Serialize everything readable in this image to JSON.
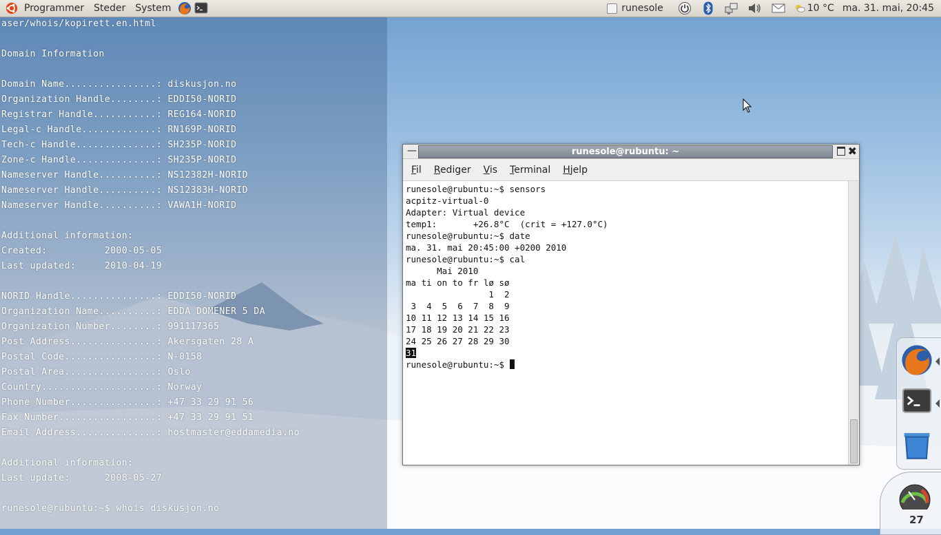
{
  "panel": {
    "menus": [
      "Programmer",
      "Steder",
      "System"
    ],
    "user": "runesole",
    "weather": "10 °C",
    "datetime": "ma. 31. mai, 20:45"
  },
  "left_terminal": {
    "lines": [
      "aser/whois/kopirett.en.html",
      "",
      "Domain Information",
      "",
      "Domain Name................: diskusjon.no",
      "Organization Handle........: EDDI50-NORID",
      "Registrar Handle...........: REG164-NORID",
      "Legal-c Handle.............: RN169P-NORID",
      "Tech-c Handle..............: SH235P-NORID",
      "Zone-c Handle..............: SH235P-NORID",
      "Nameserver Handle..........: NS12382H-NORID",
      "Nameserver Handle..........: NS12383H-NORID",
      "Nameserver Handle..........: VAWA1H-NORID",
      "",
      "Additional information:",
      "Created:          2000-05-05",
      "Last updated:     2010-04-19",
      "",
      "NORID Handle...............: EDDI50-NORID",
      "Organization Name..........: EDDA DOMENER 5 DA",
      "Organization Number........: 991117365",
      "Post Address...............: Akersgaten 28 A",
      "Postal Code................: N-0158",
      "Postal Area................: Oslo",
      "Country....................: Norway",
      "Phone Number...............: +47 33 29 91 56",
      "Fax Number.................: +47 33 29 91 51",
      "Email Address..............: hostmaster@eddamedia.no",
      "",
      "Additional information:",
      "Last update:      2008-05-27",
      "",
      "runesole@rubuntu:~$ whois diskusjon.no"
    ]
  },
  "terminal_window": {
    "title": "runesole@rubuntu: ~",
    "menu": [
      {
        "key": "F",
        "rest": "il"
      },
      {
        "key": "R",
        "rest": "ediger"
      },
      {
        "key": "V",
        "rest": "is"
      },
      {
        "key": "T",
        "rest": "erminal"
      },
      {
        "key": "H",
        "rest": "jelp"
      }
    ],
    "lines_before": [
      "runesole@rubuntu:~$ sensors",
      "acpitz-virtual-0",
      "Adapter: Virtual device",
      "temp1:       +26.8°C  (crit = +127.0°C)",
      "",
      "runesole@rubuntu:~$ date",
      "ma. 31. mai 20:45:00 +0200 2010",
      "runesole@rubuntu:~$ cal",
      "      Mai 2010",
      "ma ti on to fr lø sø",
      "                1  2",
      " 3  4  5  6  7  8  9",
      "10 11 12 13 14 15 16",
      "17 18 19 20 21 22 23",
      "24 25 26 27 28 29 30"
    ],
    "today": "31",
    "prompt": "runesole@rubuntu:~$ "
  },
  "dock": {
    "gauge_value": "27"
  }
}
